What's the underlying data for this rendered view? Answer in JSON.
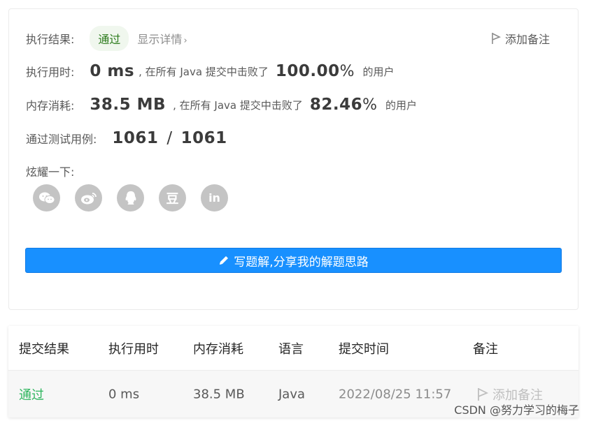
{
  "result": {
    "label": "执行结果:",
    "status": "通过",
    "detail_link": "显示详情",
    "detail_chevron": "›",
    "add_note": "添加备注"
  },
  "runtime": {
    "label": "执行用时:",
    "value": "0 ms",
    "beat_text": ", 在所有 Java 提交中击败了",
    "percent": "100.00",
    "percent_unit": "%",
    "suffix": "的用户"
  },
  "memory": {
    "label": "内存消耗:",
    "value": "38.5 MB",
    "beat_text": ", 在所有 Java 提交中击败了",
    "percent": "82.46",
    "percent_unit": "%",
    "suffix": "的用户"
  },
  "tests": {
    "label": "通过测试用例:",
    "passed": "1061",
    "separator": "/",
    "total": "1061"
  },
  "share": {
    "label": "炫耀一下:",
    "icons": [
      "wechat-icon",
      "weibo-icon",
      "qq-icon",
      "douban-icon",
      "linkedin-icon"
    ],
    "douban_glyph": "豆",
    "linkedin_glyph": "in"
  },
  "solution_button": "写题解,分享我的解题思路",
  "table": {
    "headers": [
      "提交结果",
      "执行用时",
      "内存消耗",
      "语言",
      "提交时间",
      "备注"
    ],
    "row": {
      "result": "通过",
      "runtime": "0 ms",
      "memory": "38.5 MB",
      "language": "Java",
      "time": "2022/08/25 11:57",
      "note": "添加备注"
    }
  },
  "watermark": "CSDN @努力学习的梅子",
  "colors": {
    "accent": "#1890ff",
    "pass_green": "#2db55d",
    "badge_bg": "#f0f7ee",
    "icon_gray": "#c4c4c4"
  }
}
